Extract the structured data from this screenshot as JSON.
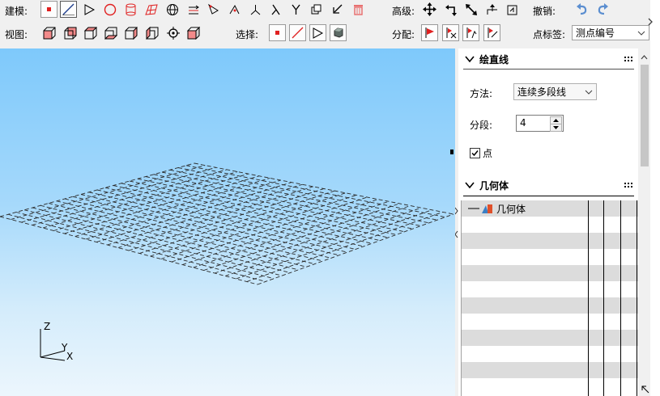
{
  "toolbar": {
    "modeling_label": "建模:",
    "view_label": "视图:",
    "advanced_label": "高级:",
    "undo_label": "撤销:",
    "select_label": "选择:",
    "assign_label": "分配:",
    "point_label_label": "点标签:",
    "point_label_value": "测点编号"
  },
  "panel": {
    "draw_line_title": "绘直线",
    "method_label": "方法:",
    "method_value": "连续多段线",
    "segments_label": "分段:",
    "segments_value": "4",
    "point_checkbox_label": "点",
    "point_checked": true,
    "geometry_title": "几何体",
    "tree_root_label": "几何体"
  },
  "axes": {
    "z": "Z",
    "y": "Y",
    "x": "X"
  },
  "colors": {
    "accent_red": "#e02020",
    "sky_top": "#7ec9fb",
    "sky_bottom": "#ecf6fd"
  }
}
